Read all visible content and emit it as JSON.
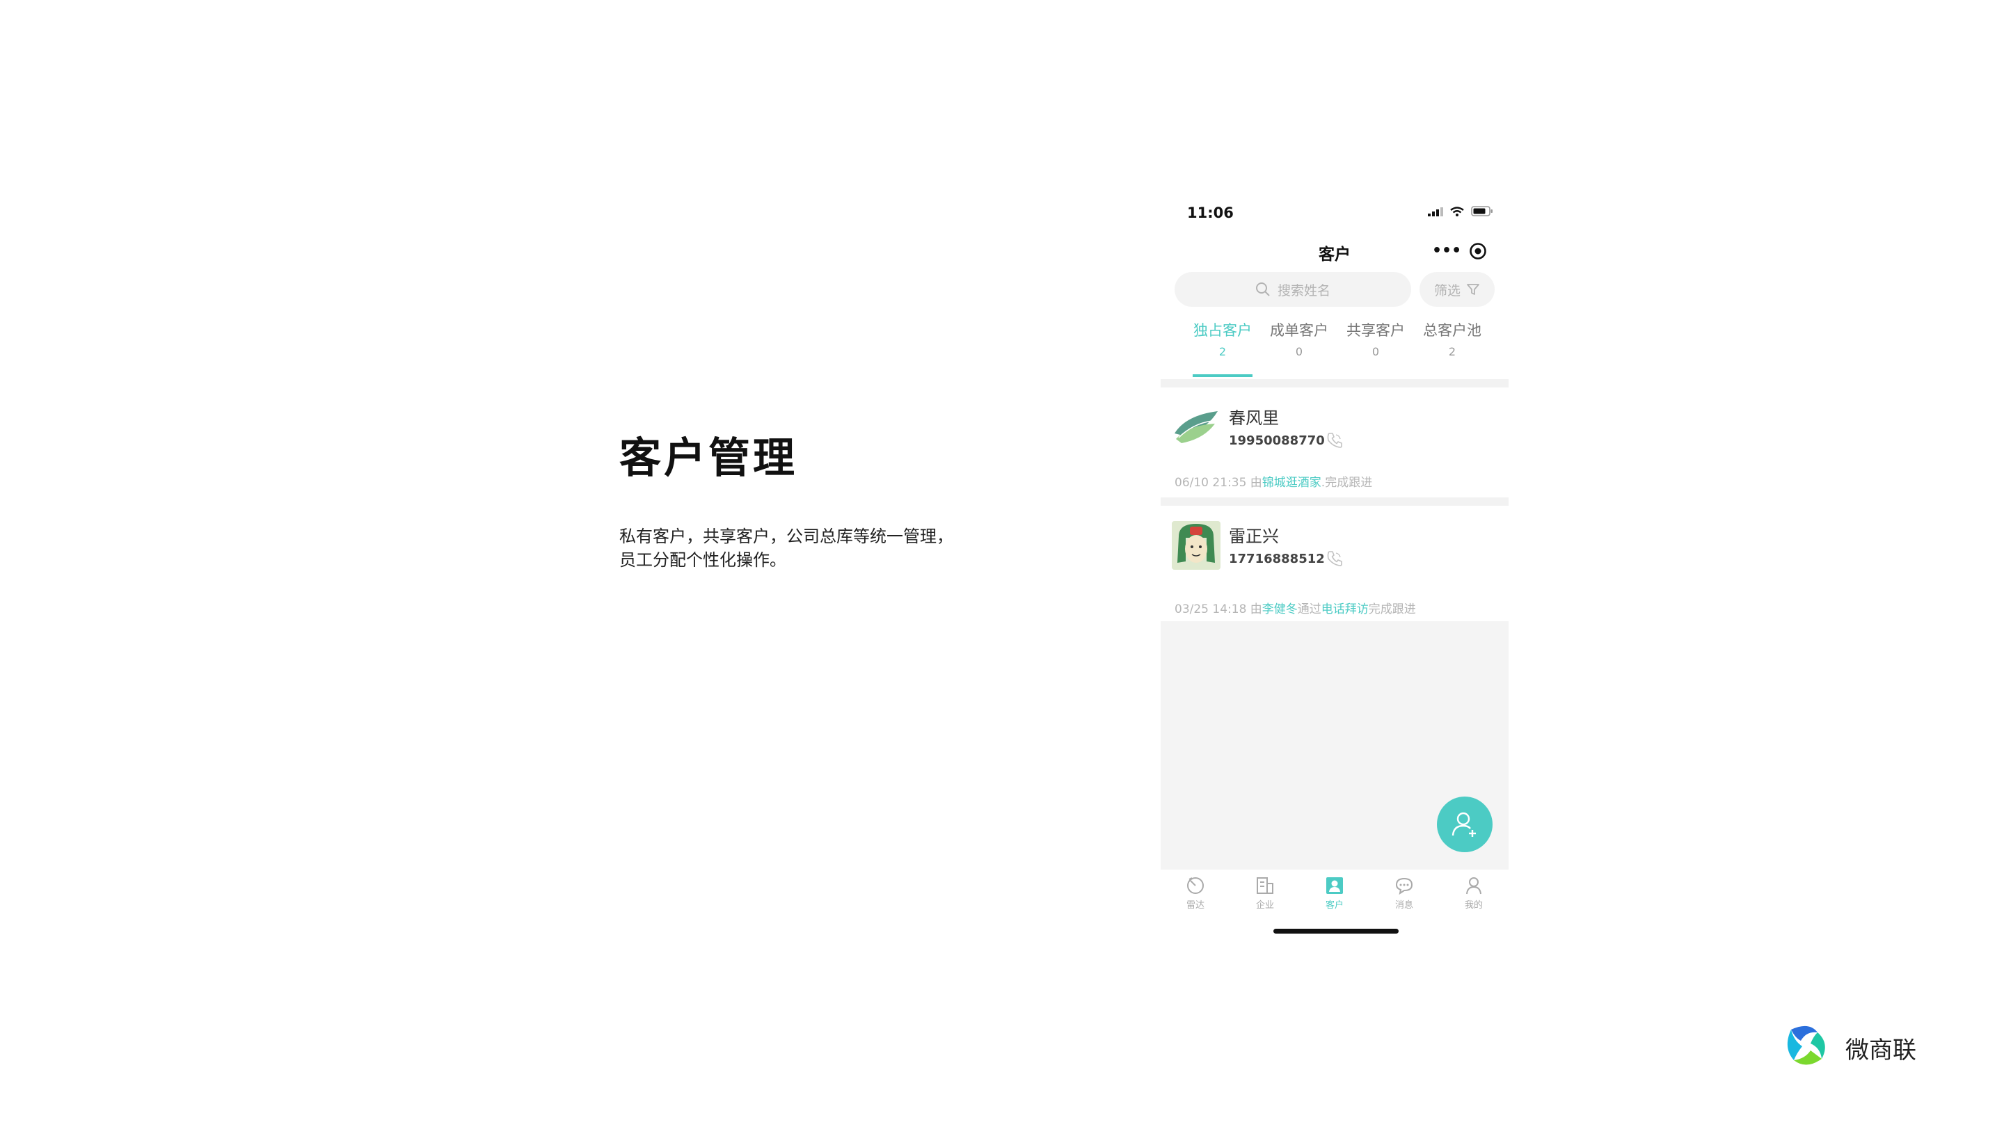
{
  "slide": {
    "title": "客户管理",
    "description_line1": "私有客户，共享客户，公司总库等统一管理，",
    "description_line2": "员工分配个性化操作。"
  },
  "status_bar": {
    "time": "11:06"
  },
  "nav": {
    "title": "客户",
    "more_icon": "more-dots-icon",
    "target_icon": "record-target-icon"
  },
  "search": {
    "placeholder": "搜索姓名",
    "filter_label": "筛选"
  },
  "tabs": [
    {
      "label": "独占客户",
      "count": "2",
      "active": true
    },
    {
      "label": "成单客户",
      "count": "0",
      "active": false
    },
    {
      "label": "共享客户",
      "count": "0",
      "active": false
    },
    {
      "label": "总客户池",
      "count": "2",
      "active": false
    }
  ],
  "customers": [
    {
      "name": "春风里",
      "phone": "19950088770",
      "followup_prefix": "06/10 21:35 由",
      "followup_person": "锦城逛酒家",
      "followup_via": "",
      "followup_suffix": ".完成跟进"
    },
    {
      "name": "雷正兴",
      "phone": "17716888512",
      "followup_prefix": "03/25 14:18 由",
      "followup_person": "李健冬",
      "followup_middle": "通过",
      "followup_via": "电话拜访",
      "followup_suffix": "完成跟进"
    }
  ],
  "tabbar": [
    {
      "label": "雷达",
      "icon": "radar-icon",
      "active": false
    },
    {
      "label": "企业",
      "icon": "company-icon",
      "active": false
    },
    {
      "label": "客户",
      "icon": "customer-icon",
      "active": true
    },
    {
      "label": "消息",
      "icon": "message-icon",
      "active": false
    },
    {
      "label": "我的",
      "icon": "profile-icon",
      "active": false
    }
  ],
  "brand": {
    "name": "微商联"
  },
  "colors": {
    "accent": "#4ccbc4",
    "background_gray": "#f4f4f4",
    "muted_text": "#b5b5b5"
  }
}
